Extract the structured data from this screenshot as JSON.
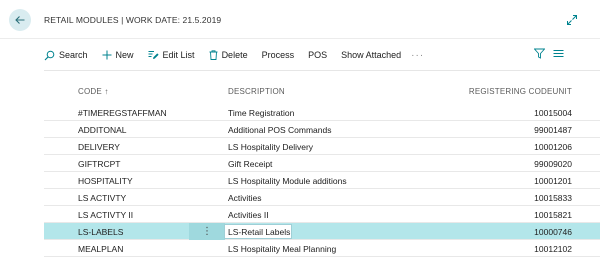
{
  "header": {
    "title": "RETAIL MODULES | WORK DATE: 21.5.2019"
  },
  "actions": {
    "search": "Search",
    "new": "New",
    "edit_list": "Edit List",
    "delete": "Delete",
    "process": "Process",
    "pos": "POS",
    "show_attached": "Show Attached",
    "more": "···"
  },
  "table": {
    "columns": {
      "code": "CODE ↑",
      "description": "DESCRIPTION",
      "codeunit": "REGISTERING CODEUNIT"
    },
    "rows": [
      {
        "code": "#TIMEREGSTAFFMAN",
        "description": "Time Registration",
        "codeunit": "10015004"
      },
      {
        "code": "ADDITONAL",
        "description": "Additional POS Commands",
        "codeunit": "99001487"
      },
      {
        "code": "DELIVERY",
        "description": "LS Hospitality Delivery",
        "codeunit": "10001206"
      },
      {
        "code": "GIFTRCPT",
        "description": "Gift Receipt",
        "codeunit": "99009020"
      },
      {
        "code": "HOSPITALITY",
        "description": "LS Hospitality Module additions",
        "codeunit": "10001201"
      },
      {
        "code": "LS ACTIVTY",
        "description": "Activities",
        "codeunit": "10015833"
      },
      {
        "code": "LS ACTIVTY II",
        "description": "Activities II",
        "codeunit": "10015821"
      },
      {
        "code": "LS-LABELS",
        "description": "LS-Retail Labels",
        "codeunit": "10000746"
      },
      {
        "code": "MEALPLAN",
        "description": "LS Hospitality Meal Planning",
        "codeunit": "10012102"
      }
    ],
    "selected_row": 7,
    "row_menu": "⋮"
  },
  "colors": {
    "accent": "#00838f",
    "selected_row": "#b3e6ea",
    "back_button_bg": "#d9ecf0"
  }
}
